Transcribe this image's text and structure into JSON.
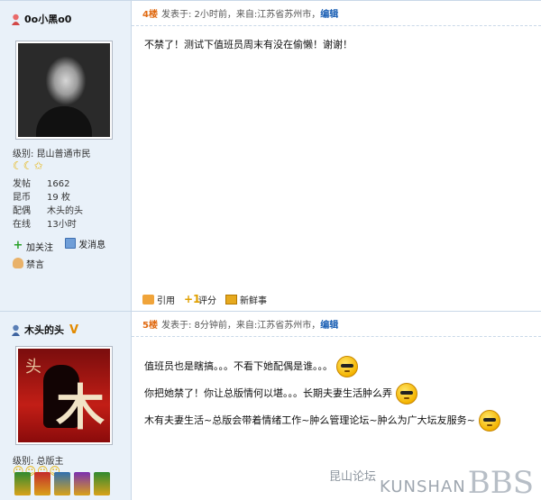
{
  "posts": [
    {
      "username": "0o小黑o0",
      "level": "级别: 昆山普通市民",
      "stars": "☾☾✩",
      "stats": [
        {
          "k": "发帖",
          "v": "1662"
        },
        {
          "k": "昆币",
          "v": "19 枚"
        },
        {
          "k": "配偶",
          "v": "木头的头"
        },
        {
          "k": "在线",
          "v": "13小时"
        }
      ],
      "actions": {
        "follow": "加关注",
        "message": "发消息",
        "ban": "禁言"
      },
      "floor": "4楼",
      "meta": "发表于: 2小时前，来自:江苏省苏州市，",
      "edit": "编辑",
      "content": [
        "不禁了！测试下值班员周末有没在偷懒！谢谢！"
      ],
      "bottom": {
        "quote": "引用",
        "rate": "评分",
        "news": "新鲜事"
      }
    },
    {
      "username": "木头的头",
      "vbadge": "V",
      "avatar_chars": {
        "small": "头",
        "big": "木"
      },
      "level": "级别: 总版主",
      "stars": "☺☺☺☺",
      "floor": "5楼",
      "meta": "发表于: 8分钟前，来自:江苏省苏州市，",
      "edit": "编辑",
      "content": [
        "值班员也是瞎搞。。。不看下她配偶是谁。。。",
        "你把她禁了！你让总版情何以堪。。。长期夫妻生活肿么弄",
        "木有夫妻生活~总版会带着情绪工作~肿么管理论坛~肿么为广大坛友服务~"
      ]
    }
  ],
  "watermark": {
    "cn": "昆山论坛",
    "en": "KUNSHAN",
    "bbs": "BBS"
  },
  "colors": {
    "sidebar": "#e9f1f9",
    "border": "#c9d8e8",
    "floor": "#e06a12",
    "link": "#1a5fb4"
  }
}
